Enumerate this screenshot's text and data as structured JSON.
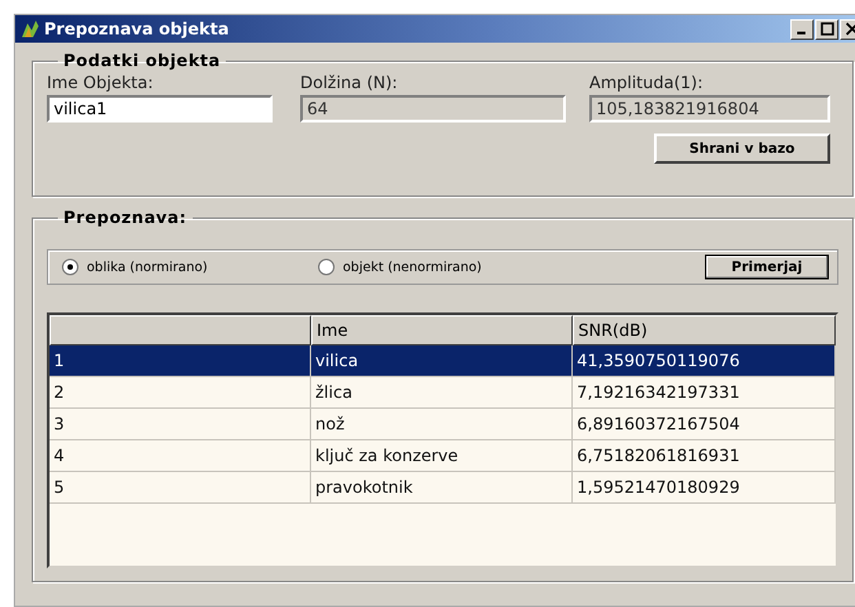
{
  "window": {
    "title": "Prepoznava objekta"
  },
  "object_group": {
    "title": "Podatki objekta",
    "fields": [
      {
        "label": "Ime Objekta:",
        "value": "vilica1",
        "disabled": false
      },
      {
        "label": "Dolžina (N):",
        "value": "64",
        "disabled": true
      },
      {
        "label": "Amplituda(1):",
        "value": "105,183821916804",
        "disabled": true
      }
    ],
    "save_button": "Shrani v bazo"
  },
  "recognition_group": {
    "title": "Prepoznava:",
    "options": [
      {
        "label": "oblika (normirano)",
        "selected": true
      },
      {
        "label": "objekt (nenormirano)",
        "selected": false
      }
    ],
    "compare_button": "Primerjaj",
    "table": {
      "columns": [
        "",
        "Ime",
        "SNR(dB)"
      ],
      "rows": [
        {
          "cells": [
            "1",
            "vilica",
            "41,3590750119076"
          ],
          "selected": true
        },
        {
          "cells": [
            "2",
            "žlica",
            "7,19216342197331"
          ],
          "selected": false
        },
        {
          "cells": [
            "3",
            "nož",
            "6,89160372167504"
          ],
          "selected": false
        },
        {
          "cells": [
            "4",
            "ključ za konzerve",
            "6,75182061816931"
          ],
          "selected": false
        },
        {
          "cells": [
            "5",
            "pravokotnik",
            "1,59521470180929"
          ],
          "selected": false
        }
      ]
    }
  }
}
